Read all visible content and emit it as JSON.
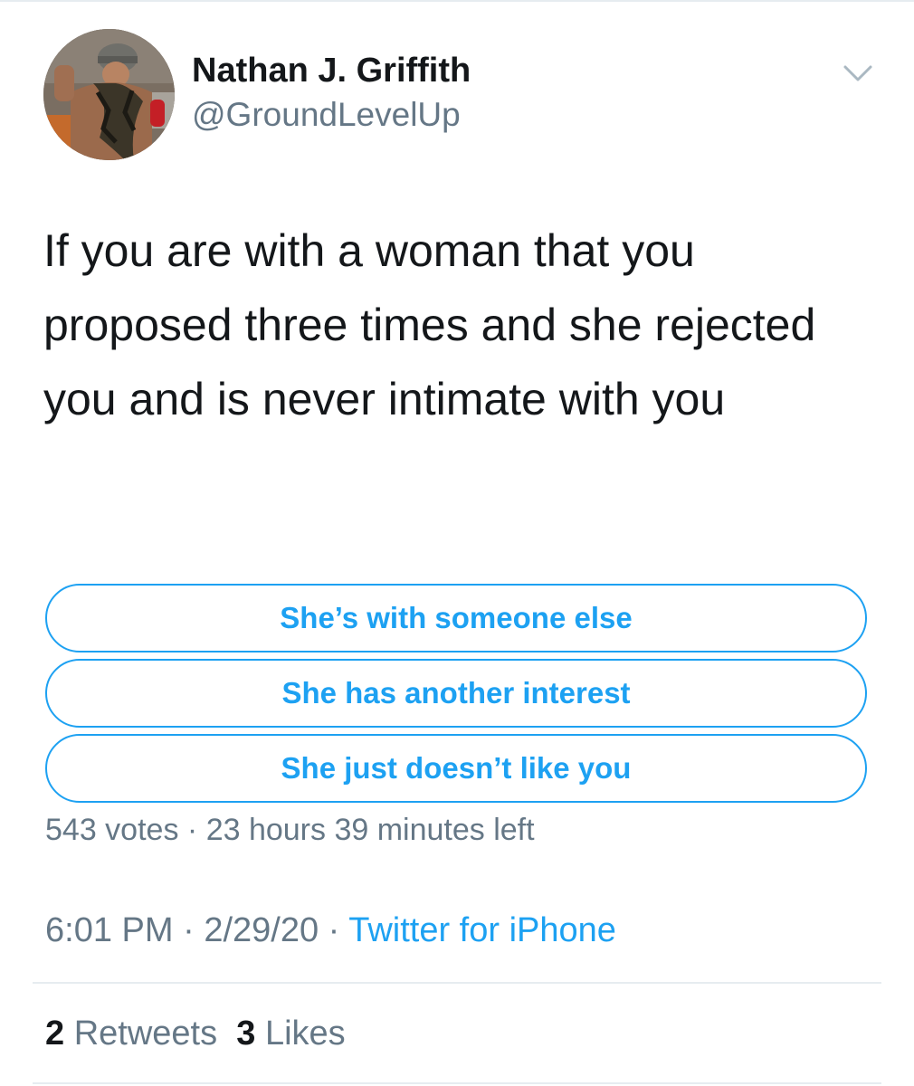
{
  "tweet": {
    "author": {
      "name": "Nathan J. Griffith",
      "handle": "@GroundLevelUp",
      "avatar_icon": "profile-photo"
    },
    "menu_icon": "chevron-down-icon",
    "text": "If you are with a woman that you proposed three times and she rejected you and is never intimate with you",
    "poll": {
      "options": [
        "She’s with someone else",
        "She has another interest",
        "She just doesn’t like you"
      ],
      "votes": "543 votes",
      "separator": "·",
      "time_left": "23 hours 39 minutes left"
    },
    "meta": {
      "time": "6:01 PM",
      "date": "2/29/20",
      "separator": "·",
      "source": "Twitter for iPhone"
    },
    "stats": {
      "retweets_count": "2",
      "retweets_label": "Retweets",
      "likes_count": "3",
      "likes_label": "Likes"
    }
  },
  "colors": {
    "accent": "#1da1f2",
    "secondary_text": "#657786",
    "primary_text": "#14171a",
    "divider": "#e6ecf0"
  }
}
